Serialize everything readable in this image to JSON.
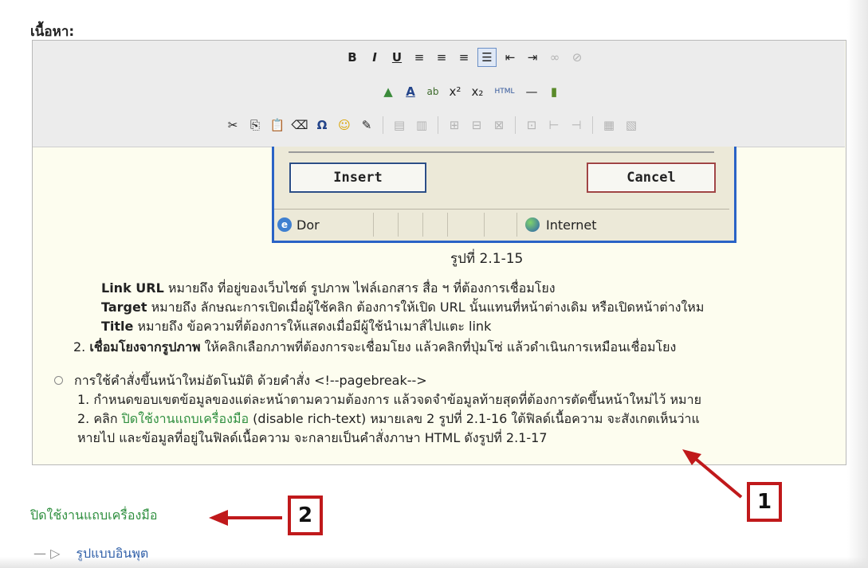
{
  "label": {
    "content": "เนื้อหา:"
  },
  "toolbar": {
    "row1": [
      "B",
      "I",
      "U",
      "≡",
      "≡",
      "≡",
      "☰",
      "⇤",
      "⇥",
      "∞",
      "⊘"
    ],
    "row2": [
      "▲",
      "A",
      "ab",
      "x²",
      "x₂",
      "HTML",
      "—",
      "▮"
    ],
    "row3": [
      "✂",
      "⎘",
      "📋",
      "⌫",
      "Ω",
      "☺",
      "✎",
      "▤",
      "▥",
      "⊞",
      "⊟",
      "⊠",
      "⊡",
      "⊢",
      "⊣",
      "⊤",
      "▦",
      "▧"
    ]
  },
  "dialog": {
    "insert": "Insert",
    "cancel": "Cancel",
    "status_left": "Dor",
    "status_right": "Internet"
  },
  "caption": "รูปที่ 2.1-15",
  "body": {
    "line1_b": "Link URL",
    "line1": " หมายถึง ที่อยู่ของเว็บไซต์ รูปภาพ ไฟล์เอกสาร สื่อ ฯ ที่ต้องการเชื่อมโยง",
    "line2_b": "Target",
    "line2": " หมายถึง ลักษณะการเปิดเมื่อผู้ใช้คลิก ต้องการให้เปิด URL นั้นแทนที่หน้าต่างเดิม หรือเปิดหน้าต่างใหม",
    "line3_b": "Title",
    "line3": " หมายถึง ข้อความที่ต้องการให้แสดงเมื่อมีผู้ใช้นำเมาส์ไปแตะ link",
    "line4_pre": "2. ",
    "line4_b": "เชื่อมโยงจากรูปภาพ",
    "line4": " ให้คลิกเลือกภาพที่ต้องการจะเชื่อมโยง แล้วคลิกที่ปุ่มโซ่ แล้วดำเนินการเหมือนเชื่อมโยง",
    "bullet": "การใช้คำสั่งขึ้นหน้าใหม่อัตโนมัติ  ด้วยคำสั่ง <!--pagebreak-->",
    "item1": "1. กำหนดขอบเขตข้อมูลของแต่ละหน้าตามความต้องการ แล้วจดจำข้อมูลท้ายสุดที่ต้องการตัดขึ้นหน้าใหม่ไว้  หมาย",
    "item2_pre": "2. คลิก ",
    "item2_green": "ปิดใช้งานแถบเครื่องมือ",
    "item2": " (disable rich-text) หมายเลข 2 รูปที่ 2.1-16 ใต้ฟิลด์เนื้อความ จะสังเกตเห็นว่าแ",
    "item3": "หายไป และข้อมูลที่อยู่ในฟิลด์เนื้อความ จะกลายเป็นคำสั่งภาษา HTML ดังรูปที่ 2.1-17"
  },
  "markers": {
    "m1": "1",
    "m2": "2"
  },
  "footer": {
    "link": "ปิดใช้งานแถบเครื่องมือ",
    "form": "รูปแบบอินพุต"
  },
  "colors": {
    "accent_red": "#c0191b",
    "link_green": "#2f8f3f"
  }
}
